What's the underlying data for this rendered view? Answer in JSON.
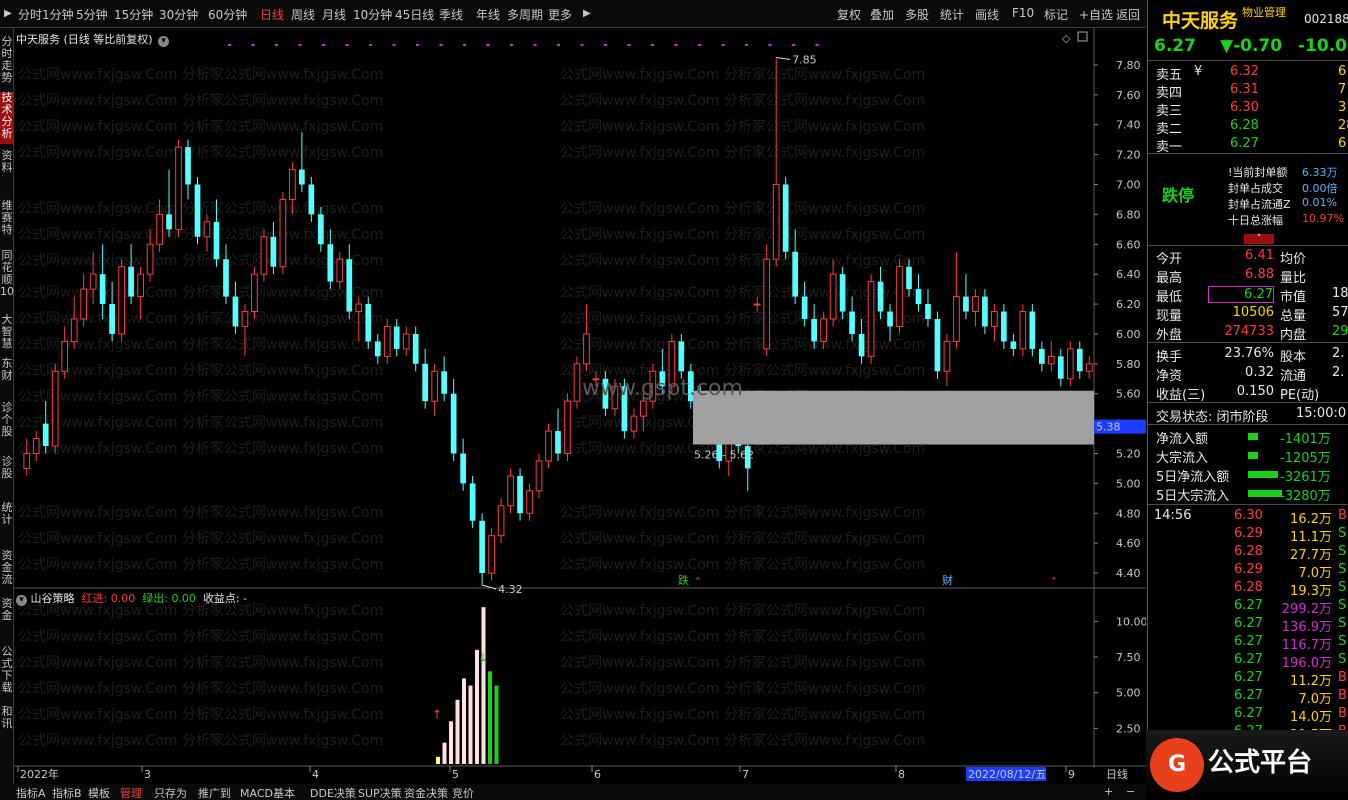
{
  "toolbar": {
    "items": [
      {
        "label": "分时",
        "active": false
      },
      {
        "label": "1分钟",
        "active": false
      },
      {
        "label": "5分钟",
        "active": false
      },
      {
        "label": "15分钟",
        "active": false
      },
      {
        "label": "30分钟",
        "active": false
      },
      {
        "label": "60分钟",
        "active": false
      },
      {
        "label": "日线",
        "active": true
      },
      {
        "label": "周线",
        "active": false
      },
      {
        "label": "月线",
        "active": false
      },
      {
        "label": "10分钟",
        "active": false
      },
      {
        "label": "45日线",
        "active": false
      },
      {
        "label": "季线",
        "active": false
      },
      {
        "label": "年线",
        "active": false
      },
      {
        "label": "多周期",
        "active": false
      },
      {
        "label": "更多",
        "active": false
      }
    ],
    "right_items": [
      "复权",
      "叠加",
      "多股",
      "统计",
      "画线",
      "F10",
      "标记",
      "+自选",
      "返回"
    ]
  },
  "left_tabs": [
    {
      "label": "分时走势",
      "active": false
    },
    {
      "label": "技术分析",
      "active": true
    },
    {
      "label": "资料",
      "active": false
    },
    {
      "label": "维赛特",
      "active": false
    },
    {
      "label": "同花顺10",
      "active": false
    },
    {
      "label": "大智慧",
      "active": false
    },
    {
      "label": "东财",
      "active": false
    },
    {
      "label": "诊个股",
      "active": false
    },
    {
      "label": "诊股",
      "active": false
    },
    {
      "label": "统计",
      "active": false
    },
    {
      "label": "资金流",
      "active": false
    },
    {
      "label": "资金",
      "active": false
    },
    {
      "label": "公式下载",
      "active": false
    },
    {
      "label": "和讯",
      "active": false
    }
  ],
  "chart": {
    "title": "中天服务 (日线 等比前复权)",
    "watermark": "公式网www.fxjgsw.Com 分析家公式网www.fxjgsw.Com",
    "site_watermark": "www.gspt.com",
    "high_label": "7.85",
    "low_label": "4.32",
    "range_label": "5.26 - 5.62",
    "right_tag": "5.38",
    "markers": {
      "die": "跌",
      "cai": "财"
    },
    "y_ticks": [
      "7.80",
      "7.60",
      "7.40",
      "7.20",
      "7.00",
      "6.80",
      "6.60",
      "6.40",
      "6.20",
      "6.00",
      "5.80",
      "5.60",
      "5.40",
      "5.20",
      "5.00",
      "4.80",
      "4.60",
      "4.40"
    ],
    "x_ticks": [
      "2022年",
      "3",
      "4",
      "5",
      "6",
      "7",
      "8",
      "9"
    ],
    "date_box": "2022/08/12/五",
    "period_btn": "日线"
  },
  "chart_data": {
    "type": "candlestick",
    "title": "中天服务 (日线 等比前复权)",
    "ylim": [
      4.3,
      7.9
    ],
    "series": [
      {
        "o": 5.1,
        "h": 5.3,
        "l": 5.05,
        "c": 5.2
      },
      {
        "o": 5.2,
        "h": 5.35,
        "l": 5.15,
        "c": 5.3
      },
      {
        "o": 5.4,
        "h": 5.55,
        "l": 5.2,
        "c": 5.25
      },
      {
        "o": 5.25,
        "h": 5.8,
        "l": 5.2,
        "c": 5.75
      },
      {
        "o": 5.75,
        "h": 6.05,
        "l": 5.7,
        "c": 5.95
      },
      {
        "o": 5.95,
        "h": 6.25,
        "l": 5.9,
        "c": 6.1
      },
      {
        "o": 6.1,
        "h": 6.4,
        "l": 6.05,
        "c": 6.3
      },
      {
        "o": 6.3,
        "h": 6.55,
        "l": 6.2,
        "c": 6.4
      },
      {
        "o": 6.4,
        "h": 6.6,
        "l": 6.1,
        "c": 6.2
      },
      {
        "o": 6.2,
        "h": 6.35,
        "l": 5.95,
        "c": 6.0
      },
      {
        "o": 6.0,
        "h": 6.5,
        "l": 5.95,
        "c": 6.45
      },
      {
        "o": 6.45,
        "h": 6.6,
        "l": 6.2,
        "c": 6.25
      },
      {
        "o": 6.25,
        "h": 6.45,
        "l": 6.1,
        "c": 6.4
      },
      {
        "o": 6.4,
        "h": 6.7,
        "l": 6.35,
        "c": 6.6
      },
      {
        "o": 6.6,
        "h": 6.9,
        "l": 6.55,
        "c": 6.8
      },
      {
        "o": 6.8,
        "h": 7.1,
        "l": 6.65,
        "c": 6.7
      },
      {
        "o": 6.7,
        "h": 7.3,
        "l": 6.65,
        "c": 7.25
      },
      {
        "o": 7.25,
        "h": 7.3,
        "l": 6.9,
        "c": 7.0
      },
      {
        "o": 7.0,
        "h": 7.05,
        "l": 6.6,
        "c": 6.65
      },
      {
        "o": 6.65,
        "h": 6.8,
        "l": 6.55,
        "c": 6.75
      },
      {
        "o": 6.75,
        "h": 6.9,
        "l": 6.45,
        "c": 6.5
      },
      {
        "o": 6.5,
        "h": 6.6,
        "l": 6.2,
        "c": 6.25
      },
      {
        "o": 6.25,
        "h": 6.35,
        "l": 6.0,
        "c": 6.05
      },
      {
        "o": 6.05,
        "h": 6.2,
        "l": 5.85,
        "c": 6.15
      },
      {
        "o": 6.15,
        "h": 6.45,
        "l": 6.1,
        "c": 6.4
      },
      {
        "o": 6.4,
        "h": 6.7,
        "l": 6.35,
        "c": 6.65
      },
      {
        "o": 6.65,
        "h": 6.75,
        "l": 6.4,
        "c": 6.45
      },
      {
        "o": 6.45,
        "h": 6.95,
        "l": 6.4,
        "c": 6.9
      },
      {
        "o": 6.9,
        "h": 7.15,
        "l": 6.8,
        "c": 7.1
      },
      {
        "o": 7.1,
        "h": 7.35,
        "l": 6.95,
        "c": 7.0
      },
      {
        "o": 7.0,
        "h": 7.05,
        "l": 6.75,
        "c": 6.8
      },
      {
        "o": 6.8,
        "h": 6.85,
        "l": 6.55,
        "c": 6.6
      },
      {
        "o": 6.6,
        "h": 6.7,
        "l": 6.3,
        "c": 6.35
      },
      {
        "o": 6.35,
        "h": 6.55,
        "l": 6.3,
        "c": 6.5
      },
      {
        "o": 6.5,
        "h": 6.6,
        "l": 6.1,
        "c": 6.15
      },
      {
        "o": 6.15,
        "h": 6.25,
        "l": 5.95,
        "c": 6.2
      },
      {
        "o": 6.2,
        "h": 6.25,
        "l": 5.9,
        "c": 5.95
      },
      {
        "o": 5.95,
        "h": 6.0,
        "l": 5.8,
        "c": 5.85
      },
      {
        "o": 5.85,
        "h": 6.1,
        "l": 5.8,
        "c": 6.05
      },
      {
        "o": 6.05,
        "h": 6.1,
        "l": 5.85,
        "c": 5.9
      },
      {
        "o": 5.9,
        "h": 6.05,
        "l": 5.85,
        "c": 6.0
      },
      {
        "o": 6.0,
        "h": 6.05,
        "l": 5.75,
        "c": 5.8
      },
      {
        "o": 5.8,
        "h": 5.9,
        "l": 5.5,
        "c": 5.55
      },
      {
        "o": 5.55,
        "h": 5.8,
        "l": 5.45,
        "c": 5.75
      },
      {
        "o": 5.75,
        "h": 5.85,
        "l": 5.55,
        "c": 5.6
      },
      {
        "o": 5.6,
        "h": 5.7,
        "l": 5.15,
        "c": 5.2
      },
      {
        "o": 5.2,
        "h": 5.3,
        "l": 4.95,
        "c": 5.0
      },
      {
        "o": 5.0,
        "h": 5.05,
        "l": 4.7,
        "c": 4.75
      },
      {
        "o": 4.75,
        "h": 4.8,
        "l": 4.32,
        "c": 4.4
      },
      {
        "o": 4.4,
        "h": 4.7,
        "l": 4.35,
        "c": 4.65
      },
      {
        "o": 4.65,
        "h": 4.9,
        "l": 4.6,
        "c": 4.85
      },
      {
        "o": 4.85,
        "h": 5.1,
        "l": 4.8,
        "c": 5.05
      },
      {
        "o": 5.05,
        "h": 5.1,
        "l": 4.75,
        "c": 4.8
      },
      {
        "o": 4.8,
        "h": 5.0,
        "l": 4.75,
        "c": 4.95
      },
      {
        "o": 4.95,
        "h": 5.2,
        "l": 4.9,
        "c": 5.15
      },
      {
        "o": 5.15,
        "h": 5.4,
        "l": 5.1,
        "c": 5.35
      },
      {
        "o": 5.35,
        "h": 5.5,
        "l": 5.15,
        "c": 5.2
      },
      {
        "o": 5.2,
        "h": 5.6,
        "l": 5.15,
        "c": 5.55
      },
      {
        "o": 5.55,
        "h": 5.85,
        "l": 5.5,
        "c": 5.8
      },
      {
        "o": 5.8,
        "h": 6.2,
        "l": 5.75,
        "c": 6.0
      },
      {
        "o": 5.7,
        "h": 5.75,
        "l": 5.65,
        "c": 5.7
      },
      {
        "o": 5.7,
        "h": 5.75,
        "l": 5.45,
        "c": 5.5
      },
      {
        "o": 5.5,
        "h": 5.7,
        "l": 5.45,
        "c": 5.65
      },
      {
        "o": 5.65,
        "h": 5.7,
        "l": 5.3,
        "c": 5.35
      },
      {
        "o": 5.35,
        "h": 5.5,
        "l": 5.3,
        "c": 5.45
      },
      {
        "o": 5.45,
        "h": 5.6,
        "l": 5.35,
        "c": 5.55
      },
      {
        "o": 5.55,
        "h": 5.8,
        "l": 5.5,
        "c": 5.75
      },
      {
        "o": 5.75,
        "h": 5.9,
        "l": 5.6,
        "c": 5.65
      },
      {
        "o": 5.65,
        "h": 6.0,
        "l": 5.6,
        "c": 5.95
      },
      {
        "o": 5.95,
        "h": 6.0,
        "l": 5.7,
        "c": 5.75
      },
      {
        "o": 5.75,
        "h": 5.8,
        "l": 5.5,
        "c": 5.55
      },
      {
        "o": 5.55,
        "h": 5.65,
        "l": 5.4,
        "c": 5.45
      },
      {
        "o": 5.45,
        "h": 5.55,
        "l": 5.3,
        "c": 5.35
      },
      {
        "o": 5.35,
        "h": 5.4,
        "l": 5.1,
        "c": 5.15
      },
      {
        "o": 5.15,
        "h": 5.4,
        "l": 5.05,
        "c": 5.35
      },
      {
        "o": 5.35,
        "h": 5.45,
        "l": 5.2,
        "c": 5.25
      },
      {
        "o": 5.25,
        "h": 5.3,
        "l": 4.95,
        "c": 5.1
      },
      {
        "o": 6.2,
        "h": 6.25,
        "l": 6.15,
        "c": 6.2
      },
      {
        "o": 5.9,
        "h": 6.6,
        "l": 5.85,
        "c": 6.5
      },
      {
        "o": 6.5,
        "h": 7.85,
        "l": 6.45,
        "c": 7.0
      },
      {
        "o": 7.0,
        "h": 7.05,
        "l": 6.5,
        "c": 6.55
      },
      {
        "o": 6.55,
        "h": 6.7,
        "l": 6.2,
        "c": 6.25
      },
      {
        "o": 6.25,
        "h": 6.35,
        "l": 6.05,
        "c": 6.1
      },
      {
        "o": 6.1,
        "h": 6.2,
        "l": 5.9,
        "c": 5.95
      },
      {
        "o": 5.95,
        "h": 6.15,
        "l": 5.9,
        "c": 6.1
      },
      {
        "o": 6.1,
        "h": 6.5,
        "l": 6.05,
        "c": 6.4
      },
      {
        "o": 6.4,
        "h": 6.45,
        "l": 6.1,
        "c": 6.15
      },
      {
        "o": 6.15,
        "h": 6.25,
        "l": 5.95,
        "c": 6.0
      },
      {
        "o": 6.0,
        "h": 6.1,
        "l": 5.8,
        "c": 5.85
      },
      {
        "o": 5.85,
        "h": 6.4,
        "l": 5.8,
        "c": 6.35
      },
      {
        "o": 6.35,
        "h": 6.45,
        "l": 6.1,
        "c": 6.15
      },
      {
        "o": 6.15,
        "h": 6.2,
        "l": 5.95,
        "c": 6.05
      },
      {
        "o": 6.05,
        "h": 6.5,
        "l": 6.0,
        "c": 6.45
      },
      {
        "o": 6.45,
        "h": 6.5,
        "l": 6.25,
        "c": 6.3
      },
      {
        "o": 6.3,
        "h": 6.4,
        "l": 6.15,
        "c": 6.2
      },
      {
        "o": 6.2,
        "h": 6.3,
        "l": 6.05,
        "c": 6.1
      },
      {
        "o": 6.1,
        "h": 6.15,
        "l": 5.7,
        "c": 5.75
      },
      {
        "o": 5.75,
        "h": 6.0,
        "l": 5.65,
        "c": 5.95
      },
      {
        "o": 5.95,
        "h": 6.55,
        "l": 5.9,
        "c": 6.25
      },
      {
        "o": 6.25,
        "h": 6.4,
        "l": 6.1,
        "c": 6.15
      },
      {
        "o": 6.15,
        "h": 6.3,
        "l": 6.05,
        "c": 6.25
      },
      {
        "o": 6.25,
        "h": 6.3,
        "l": 6.0,
        "c": 6.05
      },
      {
        "o": 6.05,
        "h": 6.2,
        "l": 5.95,
        "c": 6.15
      },
      {
        "o": 6.15,
        "h": 6.2,
        "l": 5.9,
        "c": 5.95
      },
      {
        "o": 5.95,
        "h": 6.0,
        "l": 5.85,
        "c": 5.9
      },
      {
        "o": 5.9,
        "h": 6.2,
        "l": 5.85,
        "c": 6.15
      },
      {
        "o": 6.15,
        "h": 6.2,
        "l": 5.85,
        "c": 5.9
      },
      {
        "o": 5.9,
        "h": 5.95,
        "l": 5.75,
        "c": 5.8
      },
      {
        "o": 5.8,
        "h": 5.95,
        "l": 5.75,
        "c": 5.85
      },
      {
        "o": 5.85,
        "h": 5.9,
        "l": 5.65,
        "c": 5.7
      },
      {
        "o": 5.7,
        "h": 5.95,
        "l": 5.65,
        "c": 5.9
      },
      {
        "o": 5.9,
        "h": 5.95,
        "l": 5.7,
        "c": 5.75
      },
      {
        "o": 5.75,
        "h": 5.85,
        "l": 5.7,
        "c": 5.8
      }
    ]
  },
  "indicator": {
    "title": "山谷策略",
    "red_label": "红进:",
    "red_val": "0.00",
    "green_label": "绿出:",
    "green_val": "0.00",
    "gain_label": "收益点: -",
    "y_ticks": [
      "10.00",
      "7.50",
      "5.00",
      "2.50"
    ],
    "bars": [
      0.5,
      1.5,
      3.0,
      4.5,
      6.0,
      5.5,
      8.0,
      11.0,
      6.5,
      5.5
    ],
    "bar_colors": [
      "#ffff66",
      "#ffe0e0",
      "#ffe0e0",
      "#ffe0e0",
      "#ffe0e0",
      "#ffe0e0",
      "#ffe0e0",
      "#ffe0e0",
      "#19d219",
      "#19d219"
    ]
  },
  "right_panel": {
    "name": "中天服务",
    "industry": "物业管理",
    "code": "002188",
    "price": "6.27",
    "change": "▼-0.70",
    "pct": "-10.0",
    "asks": [
      {
        "label": "卖五",
        "val": "6.32",
        "vol": "6"
      },
      {
        "label": "卖四",
        "val": "6.31",
        "vol": "7"
      },
      {
        "label": "卖三",
        "val": "6.30",
        "vol": "3"
      },
      {
        "label": "卖二",
        "val": "6.28",
        "vol": "28"
      },
      {
        "label": "卖一",
        "val": "6.27",
        "vol": "6"
      }
    ],
    "ask_mark": "¥",
    "limit_status": "跌停",
    "seal": [
      {
        "label": "!当前封单额",
        "val": "6.33万"
      },
      {
        "label": "封单占成交",
        "val": "0.00倍"
      },
      {
        "label": "封单占流通Z",
        "val": "0.01%"
      },
      {
        "label": "十日总涨幅",
        "val": "10.97%"
      }
    ],
    "stats": [
      {
        "l1": "今开",
        "v1": "6.41",
        "l2": "均价",
        "v2": ""
      },
      {
        "l1": "最高",
        "v1": "6.88",
        "l2": "量比",
        "v2": ""
      },
      {
        "l1": "最低",
        "v1": "6.27",
        "l2": "市值",
        "v2": "18"
      },
      {
        "l1": "现量",
        "v1": "10506",
        "l2": "总量",
        "v2": "57"
      },
      {
        "l1": "外盘",
        "v1": "274733",
        "l2": "内盘",
        "v2": "29"
      }
    ],
    "stats2": [
      {
        "l1": "换手",
        "v1": "23.76%",
        "l2": "股本",
        "v2": "2."
      },
      {
        "l1": "净资",
        "v1": "0.32",
        "l2": "流通",
        "v2": "2."
      },
      {
        "l1": "收益(三)",
        "v1": "0.150",
        "l2": "PE(动)",
        "v2": ""
      }
    ],
    "trade_status": "交易状态: 闭市阶段",
    "trade_time": "15:00:0",
    "flows": [
      {
        "label": "净流入额",
        "val": "-1401万"
      },
      {
        "label": "大宗流入",
        "val": "-1205万"
      },
      {
        "label": "5日净流入额",
        "val": "-3261万"
      },
      {
        "label": "5日大宗流入",
        "val": "-3280万"
      }
    ],
    "ticks": [
      {
        "t": "14:56",
        "p": "6.30",
        "v": "16.2万",
        "s": "B"
      },
      {
        "t": "",
        "p": "6.29",
        "v": "11.1万",
        "s": "S"
      },
      {
        "t": "",
        "p": "6.28",
        "v": "27.7万",
        "s": "S"
      },
      {
        "t": "",
        "p": "6.29",
        "v": "7.0万",
        "s": "S"
      },
      {
        "t": "",
        "p": "6.28",
        "v": "19.3万",
        "s": "S"
      },
      {
        "t": "",
        "p": "6.27",
        "v": "299.2万",
        "s": "S"
      },
      {
        "t": "",
        "p": "6.27",
        "v": "136.9万",
        "s": "S"
      },
      {
        "t": "",
        "p": "6.27",
        "v": "116.7万",
        "s": "S"
      },
      {
        "t": "",
        "p": "6.27",
        "v": "196.0万",
        "s": "S"
      },
      {
        "t": "",
        "p": "6.27",
        "v": "11.2万",
        "s": "B"
      },
      {
        "t": "",
        "p": "6.27",
        "v": "7.0万",
        "s": "B"
      },
      {
        "t": "",
        "p": "6.27",
        "v": "14.0万",
        "s": "B"
      },
      {
        "t": "",
        "p": "6.27",
        "v": "21.5万",
        "s": "B"
      }
    ]
  },
  "bottom_tabs": [
    "指标A",
    "指标B",
    "模板",
    "管理",
    "只存为",
    "推广到",
    "MACD基本",
    "DDE决策",
    "SUP决策",
    "资金决策",
    "竞价"
  ],
  "logo_text": "公式平台"
}
